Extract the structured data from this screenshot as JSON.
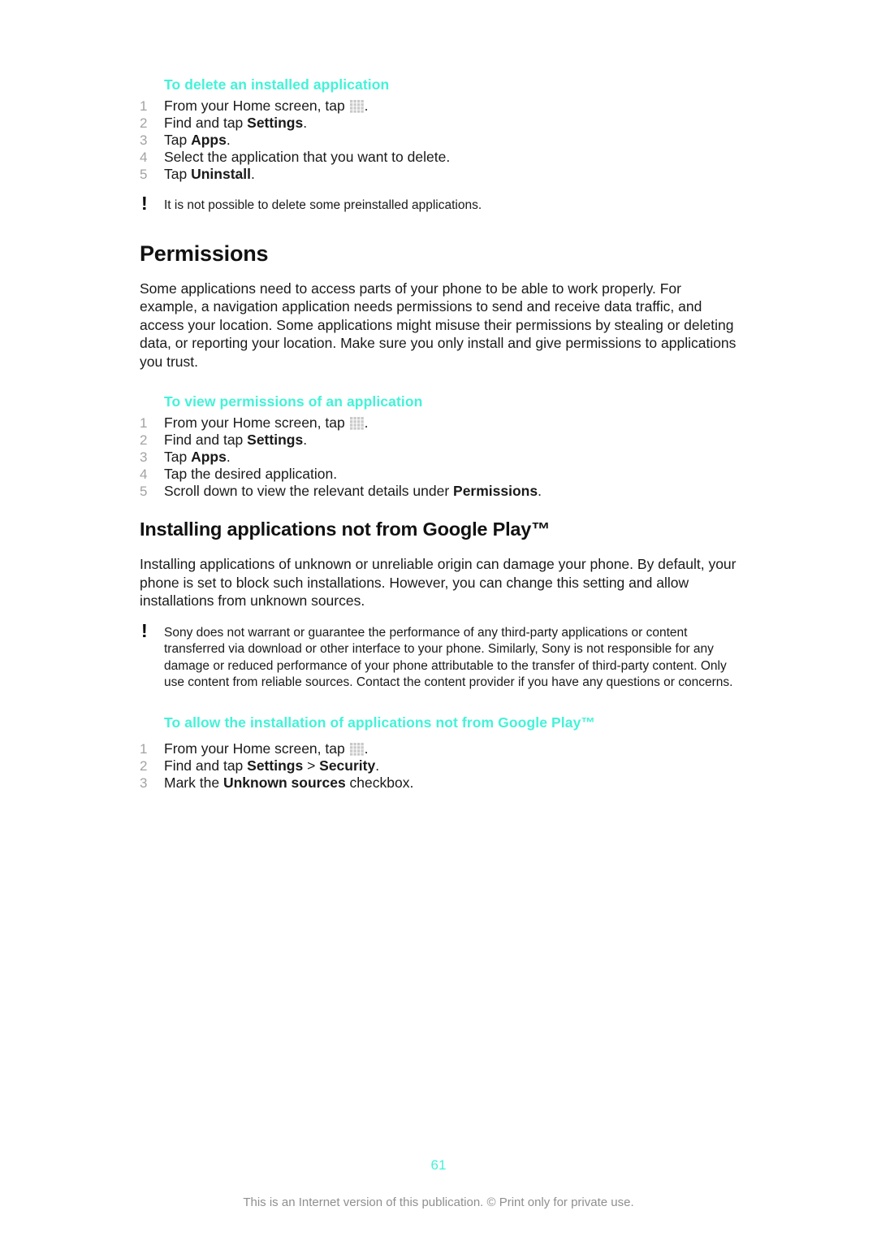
{
  "colors": {
    "accent": "#44f2d8",
    "text": "#1a1a1a",
    "step_number": "#a3a3a3",
    "footer": "#8f8f8f"
  },
  "sections": {
    "delete_app": {
      "heading": "To delete an installed application",
      "steps": [
        {
          "num": "1",
          "pre": "From your Home screen, tap ",
          "icon": "app-grid-icon",
          "post": "."
        },
        {
          "num": "2",
          "pre": "Find and tap ",
          "bold": "Settings",
          "post": "."
        },
        {
          "num": "3",
          "pre": "Tap ",
          "bold": "Apps",
          "post": "."
        },
        {
          "num": "4",
          "pre": "Select the application that you want to delete.",
          "post": ""
        },
        {
          "num": "5",
          "pre": "Tap ",
          "bold": "Uninstall",
          "post": "."
        }
      ],
      "note": "It is not possible to delete some preinstalled applications."
    },
    "permissions": {
      "heading": "Permissions",
      "body": "Some applications need to access parts of your phone to be able to work properly. For example, a navigation application needs permissions to send and receive data traffic, and access your location. Some applications might misuse their permissions by stealing or deleting data, or reporting your location. Make sure you only install and give permissions to applications you trust."
    },
    "view_permissions": {
      "heading": "To view permissions of an application",
      "steps": [
        {
          "num": "1",
          "pre": "From your Home screen, tap ",
          "icon": "app-grid-icon",
          "post": "."
        },
        {
          "num": "2",
          "pre": "Find and tap ",
          "bold": "Settings",
          "post": "."
        },
        {
          "num": "3",
          "pre": "Tap ",
          "bold": "Apps",
          "post": "."
        },
        {
          "num": "4",
          "pre": "Tap the desired application.",
          "post": ""
        },
        {
          "num": "5",
          "pre": "Scroll down to view the relevant details under ",
          "bold": "Permissions",
          "post": "."
        }
      ]
    },
    "installing": {
      "heading": "Installing applications not from Google Play™",
      "body": "Installing applications of unknown or unreliable origin can damage your phone. By default, your phone is set to block such installations. However, you can change this setting and allow installations from unknown sources.",
      "note": "Sony does not warrant or guarantee the performance of any third-party applications or content transferred via download or other interface to your phone. Similarly, Sony is not responsible for any damage or reduced performance of your phone attributable to the transfer of third-party content. Only use content from reliable sources. Contact the content provider if you have any questions or concerns."
    },
    "allow_install": {
      "heading": "To allow the installation of applications not from Google Play™",
      "steps": [
        {
          "num": "1",
          "pre": "From your Home screen, tap ",
          "icon": "app-grid-icon",
          "post": "."
        },
        {
          "num": "2",
          "pre": "Find and tap ",
          "bold": "Settings",
          "mid": " > ",
          "bold2": "Security",
          "post": "."
        },
        {
          "num": "3",
          "pre": "Mark the ",
          "bold": "Unknown sources",
          "post": " checkbox."
        }
      ]
    }
  },
  "footer": {
    "page_number": "61",
    "note": "This is an Internet version of this publication. © Print only for private use."
  }
}
